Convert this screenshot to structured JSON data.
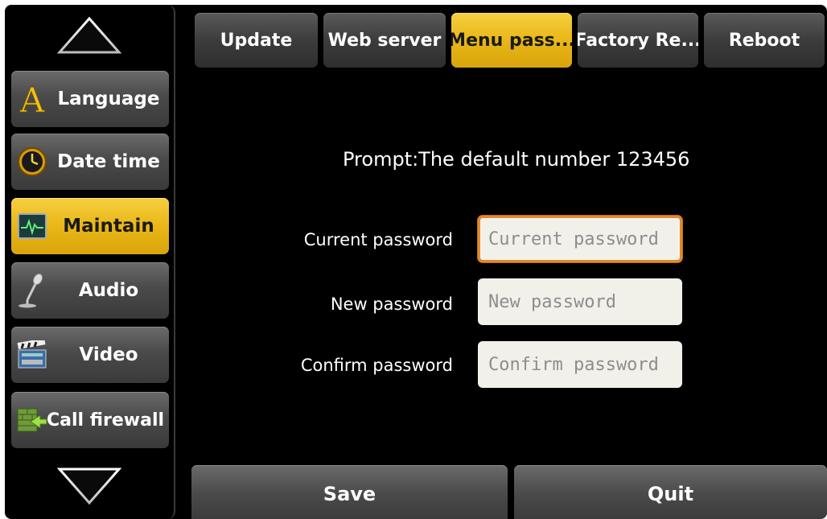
{
  "sidebar": {
    "items": [
      {
        "label": "Language",
        "icon": "letter-a-icon"
      },
      {
        "label": "Date time",
        "icon": "clock-icon"
      },
      {
        "label": "Maintain",
        "icon": "monitor-pulse-icon"
      },
      {
        "label": "Audio",
        "icon": "microphone-icon"
      },
      {
        "label": "Video",
        "icon": "clapperboard-icon"
      },
      {
        "label": "Call firewall",
        "icon": "firewall-icon"
      }
    ],
    "active": "Maintain"
  },
  "tabs": [
    {
      "label": "Update"
    },
    {
      "label": "Web server"
    },
    {
      "label": "Menu pass..."
    },
    {
      "label": "Factory Re..."
    },
    {
      "label": "Reboot"
    }
  ],
  "active_tab": "Menu pass...",
  "content": {
    "prompt": "Prompt:The default number 123456",
    "fields": [
      {
        "label": "Current password",
        "placeholder": "Current password",
        "value": ""
      },
      {
        "label": "New password",
        "placeholder": "New password",
        "value": ""
      },
      {
        "label": "Confirm password",
        "placeholder": "Confirm password",
        "value": ""
      }
    ]
  },
  "footer": {
    "save_label": "Save",
    "quit_label": "Quit"
  },
  "colors": {
    "accent": "#e9b718",
    "focus_border": "#e08a2a",
    "background": "#000000"
  }
}
